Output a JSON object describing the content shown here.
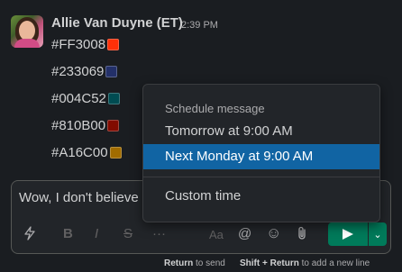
{
  "message": {
    "sender": "Allie Van Duyne (ET)",
    "time": "2:39 PM",
    "colors": [
      {
        "label": "#FF3008",
        "hex": "#FF3008"
      },
      {
        "label": "#233069",
        "hex": "#233069"
      },
      {
        "label": "#004C52",
        "hex": "#004C52"
      },
      {
        "label": "#810B00",
        "hex": "#810B00"
      },
      {
        "label": "#A16C00",
        "hex": "#A16C00"
      }
    ]
  },
  "composer": {
    "draft": "Wow, I don't believe"
  },
  "toolbar": {
    "shortcuts_icon": "lightning-icon",
    "bold_label": "B",
    "italic_label": "I",
    "strike_label": "S",
    "more_label": "···",
    "format_label": "Aa",
    "mention_label": "@",
    "emoji_label": "☺",
    "attach_label": "⎘",
    "dropdown_label": "⌄"
  },
  "hints": {
    "send_key": "Return",
    "send_text": "to send",
    "newline_key": "Shift + Return",
    "newline_text": "to add a new line"
  },
  "schedule_menu": {
    "header": "Schedule message",
    "items": [
      {
        "label": "Tomorrow at 9:00 AM",
        "highlighted": false
      },
      {
        "label": "Next Monday at 9:00 AM",
        "highlighted": true
      },
      {
        "label": "Custom time",
        "highlighted": false
      }
    ]
  }
}
